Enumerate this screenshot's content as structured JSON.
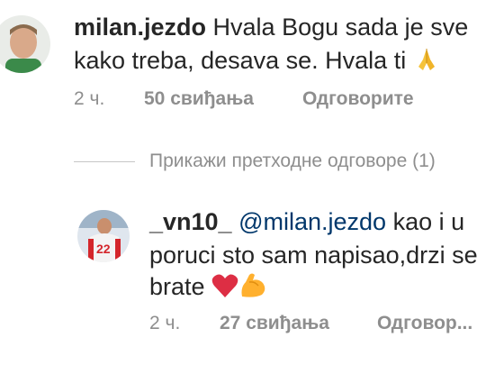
{
  "comment1": {
    "username": "milan.jezdo",
    "text_line1": "Hvala Bogu sada je sve",
    "text_line2": "kako treba, desava se. Hvala ti",
    "emoji_icon": "folded-hands-icon",
    "time": "2 ч.",
    "likes": "50 свиђања",
    "reply_label": "Одговорите"
  },
  "view_previous": {
    "label": "Прикажи претходне одговоре (1)"
  },
  "comment2": {
    "username": "_vn10_",
    "mention": "@milan.jezdo",
    "text_line1_rest": " kao i u",
    "text_line2": "poruci sto sam napisao,drzi se",
    "text_line3": "brate",
    "emoji_icons": [
      "red-heart-icon",
      "flexed-biceps-icon"
    ],
    "time": "2 ч.",
    "likes": "27 свиђања",
    "reply_label": "Одговор..."
  },
  "colors": {
    "text": "#262626",
    "muted": "#8e8e8e",
    "mention": "#00376b"
  }
}
